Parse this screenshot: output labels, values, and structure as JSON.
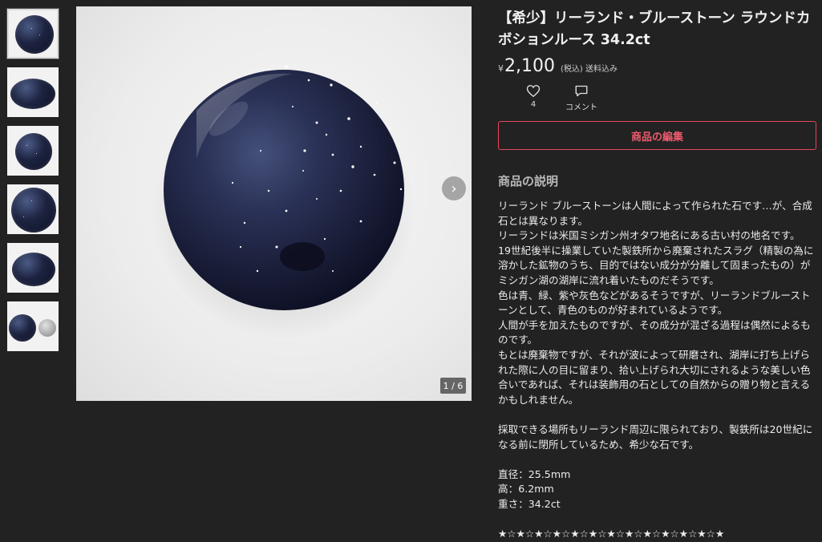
{
  "product": {
    "title": "【希少】リーランド・ブルーストーン ラウンドカボションルース 34.2ct",
    "currency_symbol": "¥",
    "price": "2,100",
    "tax_note": "(税込) 送料込み",
    "likes_count": "4",
    "comment_label": "コメント",
    "edit_button_label": "商品の編集"
  },
  "gallery": {
    "counter": "1 / 6",
    "thumbnail_count": 6,
    "selected_index": 0
  },
  "description": {
    "heading": "商品の説明",
    "lines": [
      "リーランド ブルーストーンは人間によって作られた石です…が、合成石とは異なります。",
      "リーランドは米国ミシガン州オタワ地名にある古い村の地名です。",
      "19世紀後半に操業していた製鉄所から廃棄されたスラグ（精製の為に溶かした鉱物のうち、目的ではない成分が分離して固まったもの）がミシガン湖の湖岸に流れ着いたものだそうです。",
      "色は青、緑、紫や灰色などがあるそうですが、リーランドブルーストーンとして、青色のものが好まれているようです。",
      "人間が手を加えたものですが、その成分が混ざる過程は偶然によるものです。",
      "もとは廃棄物ですが、それが波によって研磨され、湖岸に打ち上げられた際に人の目に留まり、拾い上げられ大切にされるような美しい色合いであれば、それは装飾用の石としての自然からの贈り物と言えるかもしれません。",
      "",
      "採取できる場所もリーランド周辺に限られており、製鉄所は20世紀になる前に閉所しているため、希少な石です。",
      "",
      "直径：25.5mm",
      "高：6.2mm",
      "重さ：34.2ct",
      "",
      "★☆★☆★☆★☆★☆★☆★☆★☆★☆★☆★☆★☆★"
    ]
  },
  "colors": {
    "background": "#222222",
    "accent": "#e0475d",
    "stone_dark": "#1a1f3a"
  }
}
